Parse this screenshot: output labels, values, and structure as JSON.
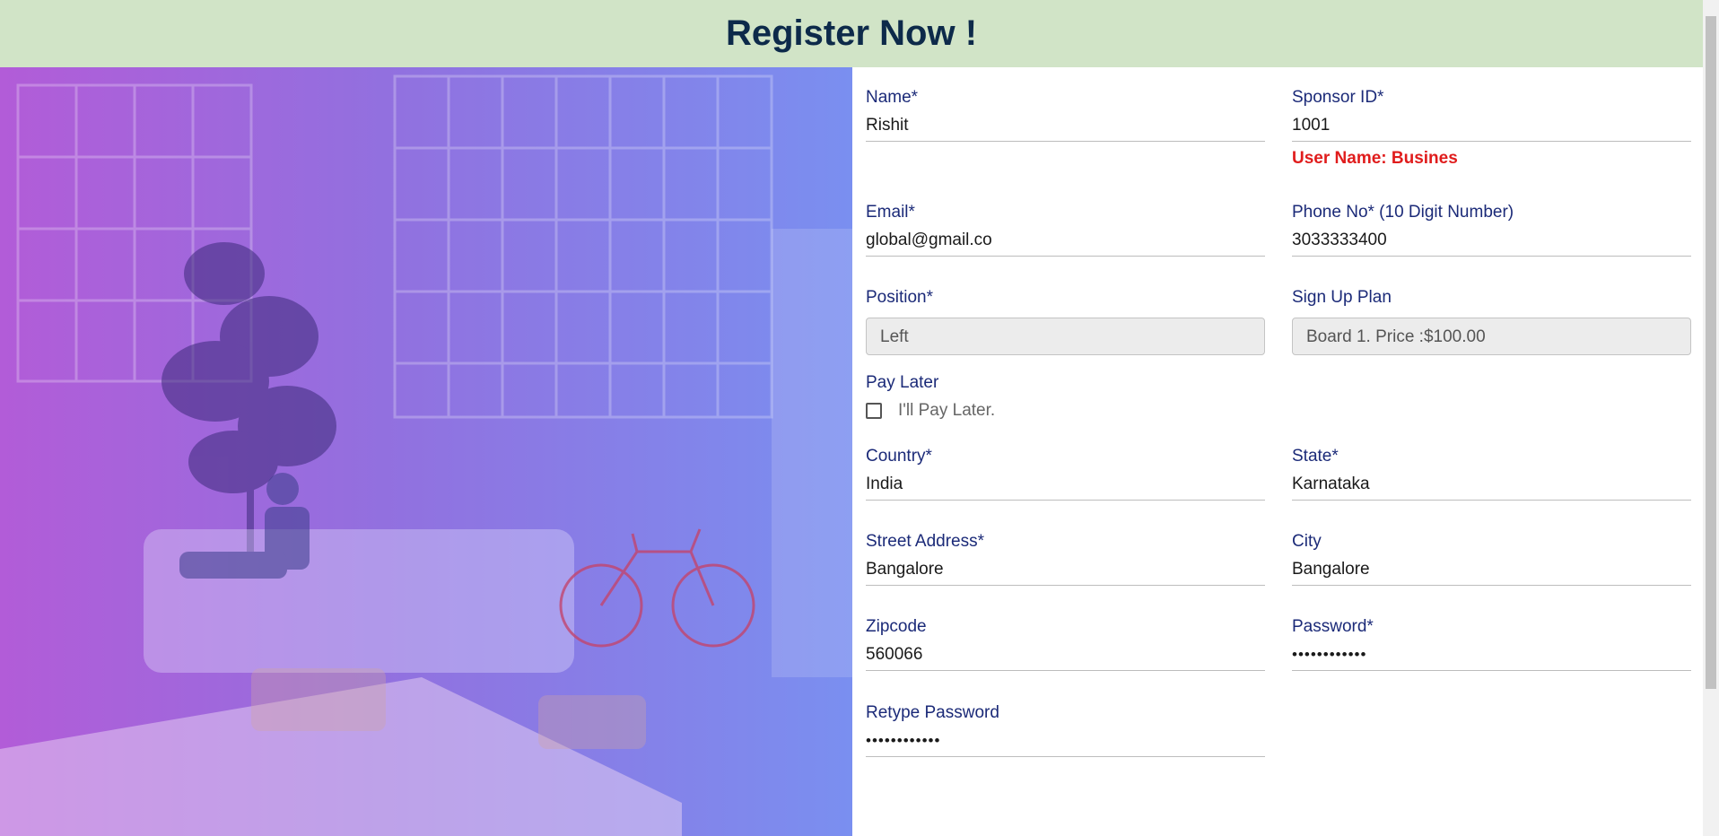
{
  "header": {
    "title": "Register Now !"
  },
  "form": {
    "name": {
      "label": "Name*",
      "value": "Rishit"
    },
    "sponsor_id": {
      "label": "Sponsor ID*",
      "value": "1001",
      "message": "User Name: Busines"
    },
    "email": {
      "label": "Email*",
      "value": "global@gmail.co"
    },
    "phone": {
      "label": "Phone No* (10 Digit Number)",
      "value": "3033333400"
    },
    "position": {
      "label": "Position*",
      "selected": "Left"
    },
    "signup_plan": {
      "label": "Sign Up Plan",
      "selected": "Board 1. Price :$100.00"
    },
    "pay_later": {
      "label": "Pay Later",
      "checkbox_label": "I'll Pay Later."
    },
    "country": {
      "label": "Country*",
      "value": "India"
    },
    "state": {
      "label": "State*",
      "value": "Karnataka"
    },
    "street_address": {
      "label": "Street Address*",
      "value": "Bangalore"
    },
    "city": {
      "label": "City",
      "value": "Bangalore"
    },
    "zipcode": {
      "label": "Zipcode",
      "value": "560066"
    },
    "password": {
      "label": "Password*",
      "value": "••••••••••••"
    },
    "retype_password": {
      "label": "Retype Password",
      "value": "••••••••••••"
    }
  },
  "colors": {
    "header_bg": "#d1e4c7",
    "title": "#0d2a4a",
    "label": "#1b2a78",
    "error": "#e01c1c"
  }
}
